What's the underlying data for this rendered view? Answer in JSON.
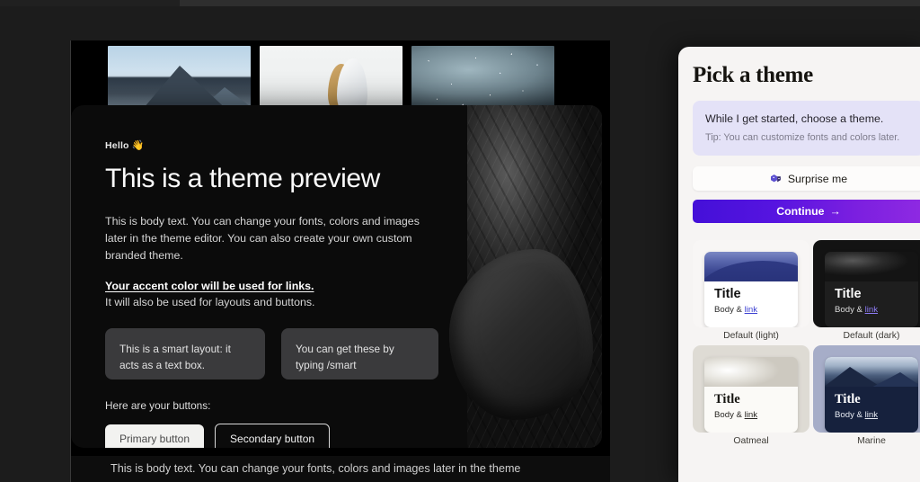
{
  "preview": {
    "greeting_text": "Hello",
    "greeting_emoji": "👋",
    "title": "This is a theme preview",
    "paragraph": "This is body text. You can change your fonts, colors and images later in the theme editor. You can also create your own custom branded theme.",
    "accent_line": "Your accent color will be used for links.",
    "accent_sub": "It will also be used for layouts and buttons.",
    "smart_boxes": [
      "This is a smart layout: it acts as a text box.",
      "You can get these by typing /smart"
    ],
    "buttons_label": "Here are your buttons:",
    "primary_button": "Primary button",
    "secondary_button": "Secondary button",
    "below_text": "This is body text. You can change your fonts, colors and images later in the theme"
  },
  "image_strip": [
    {
      "name": "mountain-photo"
    },
    {
      "name": "bird-photo"
    },
    {
      "name": "stars-photo"
    }
  ],
  "theme_panel": {
    "heading": "Pick a theme",
    "tip": {
      "main": "While I get started, choose a theme.",
      "sub": "Tip: You can customize fonts and colors later."
    },
    "surprise_button": {
      "label": "Surprise me",
      "icon": "dice-icon",
      "icon_color": "#3d2b9e"
    },
    "continue_button": {
      "label": "Continue",
      "arrow": "→",
      "gradient_from": "#4410d8",
      "gradient_to": "#8f2ae2"
    },
    "themes": [
      {
        "caption": "Default (light)",
        "title": "Title",
        "body": "Body & ",
        "link": "link"
      },
      {
        "caption": "Default (dark)",
        "title": "Title",
        "body": "Body & ",
        "link": "link"
      },
      {
        "caption": "Oatmeal",
        "title": "Title",
        "body": "Body & ",
        "link": "link"
      },
      {
        "caption": "Marine",
        "title": "Title",
        "body": "Body & ",
        "link": "link"
      }
    ]
  }
}
